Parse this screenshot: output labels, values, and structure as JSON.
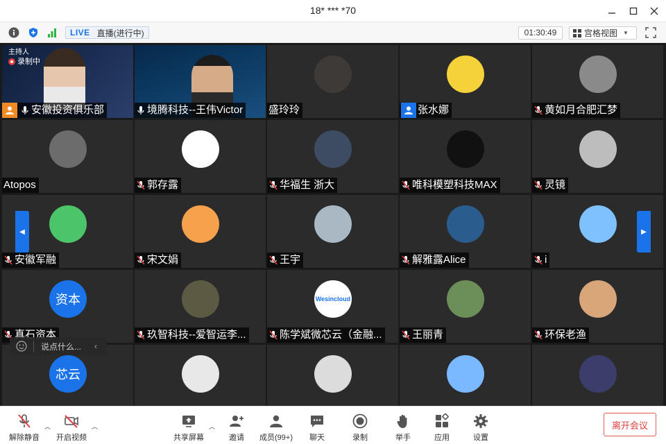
{
  "window": {
    "title": "18* *** *70"
  },
  "infobar": {
    "live_tag": "LIVE",
    "live_status": "直播(进行中)",
    "timer": "01:30:49",
    "view_mode": "宫格视图"
  },
  "host_overlay": {
    "host_label": "主持人",
    "recording_label": "录制中"
  },
  "participants": [
    {
      "name": "安徽投资俱乐部",
      "video": true,
      "host": true,
      "mic": "on"
    },
    {
      "name": "境腾科技--王伟Victor",
      "video": true,
      "mic": "on",
      "active": true
    },
    {
      "name": "盛玲玲",
      "mic": "none"
    },
    {
      "name": "张水娜",
      "mic": "none",
      "host_icon": true
    },
    {
      "name": "黄如月合肥汇梦",
      "mic": "muted"
    },
    {
      "name": "Atopos",
      "mic": "none"
    },
    {
      "name": "郭存露",
      "mic": "muted"
    },
    {
      "name": "华福生 浙大",
      "mic": "muted"
    },
    {
      "name": "唯科模塑科技MAX",
      "mic": "muted"
    },
    {
      "name": "灵镜",
      "mic": "muted"
    },
    {
      "name": "安徽军融",
      "mic": "muted"
    },
    {
      "name": "宋文娟",
      "mic": "muted"
    },
    {
      "name": "王宇",
      "mic": "muted"
    },
    {
      "name": "解雅露Alice",
      "mic": "muted"
    },
    {
      "name": "i",
      "mic": "muted"
    },
    {
      "name": "真石资本",
      "mic": "muted",
      "avatar_text": "资本"
    },
    {
      "name": "玖智科技--爱智运李...",
      "mic": "muted"
    },
    {
      "name": "陈学斌微芯云（金融...",
      "mic": "muted",
      "avatar_text": "Wesincloud"
    },
    {
      "name": "王丽青",
      "mic": "muted"
    },
    {
      "name": "环保老渔",
      "mic": "muted"
    },
    {
      "name": "",
      "mic": "none",
      "avatar_text": "芯云"
    },
    {
      "name": "",
      "mic": "none"
    },
    {
      "name": "",
      "mic": "none"
    },
    {
      "name": "",
      "mic": "none"
    },
    {
      "name": "",
      "mic": "none"
    }
  ],
  "chat": {
    "placeholder": "说点什么..."
  },
  "toolbar": {
    "unmute": "解除静音",
    "start_video": "开启视频",
    "share_screen": "共享屏幕",
    "invite": "邀请",
    "members": "成员(99+)",
    "chat": "聊天",
    "record": "录制",
    "raise_hand": "举手",
    "apps": "应用",
    "settings": "设置",
    "leave": "离开会议"
  },
  "colors": {
    "accent": "#1a73e8",
    "leave": "#e03e3e",
    "active_outline": "#3ad45a"
  }
}
